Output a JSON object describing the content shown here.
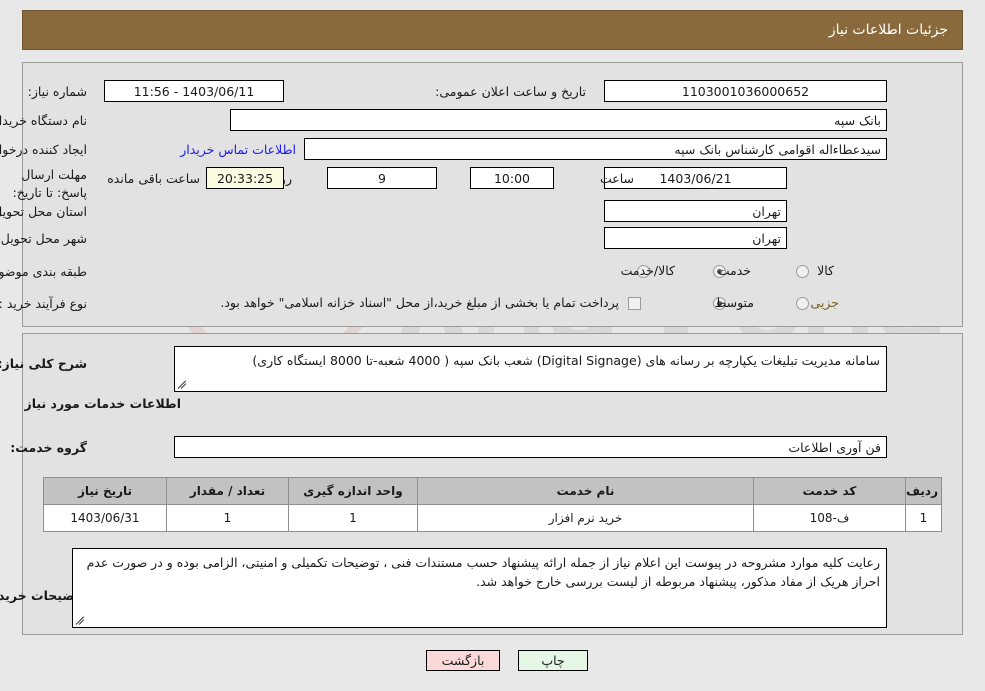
{
  "header": {
    "title": "جزئیات اطلاعات نیاز"
  },
  "top_panel": {
    "need_number_label": "شماره نیاز:",
    "need_number_value": "1103001036000652",
    "announce_datetime_label": "تاریخ و ساعت اعلان عمومی:",
    "announce_datetime_value": "1403/06/11 - 11:56",
    "buyer_org_label": "نام دستگاه خریدار:",
    "buyer_org_value": "بانک سپه",
    "requester_label": "ایجاد کننده درخواست:",
    "requester_value": "سیدعطاءاله اقوامی کارشناس بانک سپه",
    "buyer_contact_link": "اطلاعات تماس خریدار",
    "deadline_label": "مهلت ارسال پاسخ: تا تاریخ:",
    "deadline_date": "1403/06/21",
    "deadline_hour_label": "ساعت",
    "deadline_hour_value": "10:00",
    "days_remaining": "9",
    "days_and_label": "روز و",
    "countdown_value": "20:33:25",
    "countdown_suffix_label": "ساعت باقی مانده",
    "province_label": "استان محل تحویل:",
    "province_value": "تهران",
    "city_label": "شهر محل تحویل:",
    "city_value": "تهران",
    "category_label": "طبقه بندی موضوعی:",
    "category_options": [
      {
        "label": "کالا",
        "checked": false
      },
      {
        "label": "خدمت",
        "checked": true
      },
      {
        "label": "کالا/خدمت",
        "checked": false
      }
    ],
    "process_type_label": "نوع فرآیند خرید :",
    "process_options": [
      {
        "label": "جزیی",
        "checked": false
      },
      {
        "label": "متوسط",
        "checked": true
      }
    ],
    "treasury_checkbox_label": "پرداخت تمام یا بخشی از مبلغ خرید،از محل \"اسناد خزانه اسلامی\" خواهد بود.",
    "treasury_checked": false
  },
  "mid_panel": {
    "general_desc_label": "شرح کلی نیاز:",
    "general_desc_value": "سامانه مدیریت تبلیغات یکپارچه بر رسانه های (Digital Signage) شعب بانک سپه ( 4000 شعبه-تا 8000 ایستگاه کاری)",
    "services_heading": "اطلاعات خدمات مورد نیاز",
    "service_group_label": "گروه خدمت:",
    "service_group_value": "فن آوری اطلاعات",
    "table": {
      "columns": [
        "ردیف",
        "کد خدمت",
        "نام خدمت",
        "واحد اندازه گیری",
        "تعداد / مقدار",
        "تاریخ نیاز"
      ],
      "rows": [
        {
          "row_no": "1",
          "service_code": "ف-108",
          "service_name": "خرید نرم افزار",
          "unit": "1",
          "quantity": "1",
          "need_date": "1403/06/31"
        }
      ]
    },
    "buyer_notes_label": "توضیحات خریدار:",
    "buyer_notes_value": "رعایت کلیه موارد مشروحه در پیوست این اعلام نیاز از جمله ارائه پیشنهاد حسب مستندات فنی ، توضیحات تکمیلی و امنیتی، الزامی بوده و در صورت عدم احراز هریک از مفاد مذکور، پیشنهاد مربوطه از لیست بررسی خارج خواهد شد."
  },
  "footer": {
    "print_label": "چاپ",
    "back_label": "بازگشت"
  },
  "watermark": {
    "text": "AriaTender.net"
  },
  "colors": {
    "header_bg": "#8a6a3d",
    "panel_bg": "#e2e2e2",
    "page_bg": "#e8e8e8",
    "link": "#1a1aee",
    "table_header_bg": "#c2c2c2",
    "countdown_bg": "#fbfbe2",
    "print_btn_bg": "#e4f7e4",
    "back_btn_bg": "#fbd9d9"
  }
}
